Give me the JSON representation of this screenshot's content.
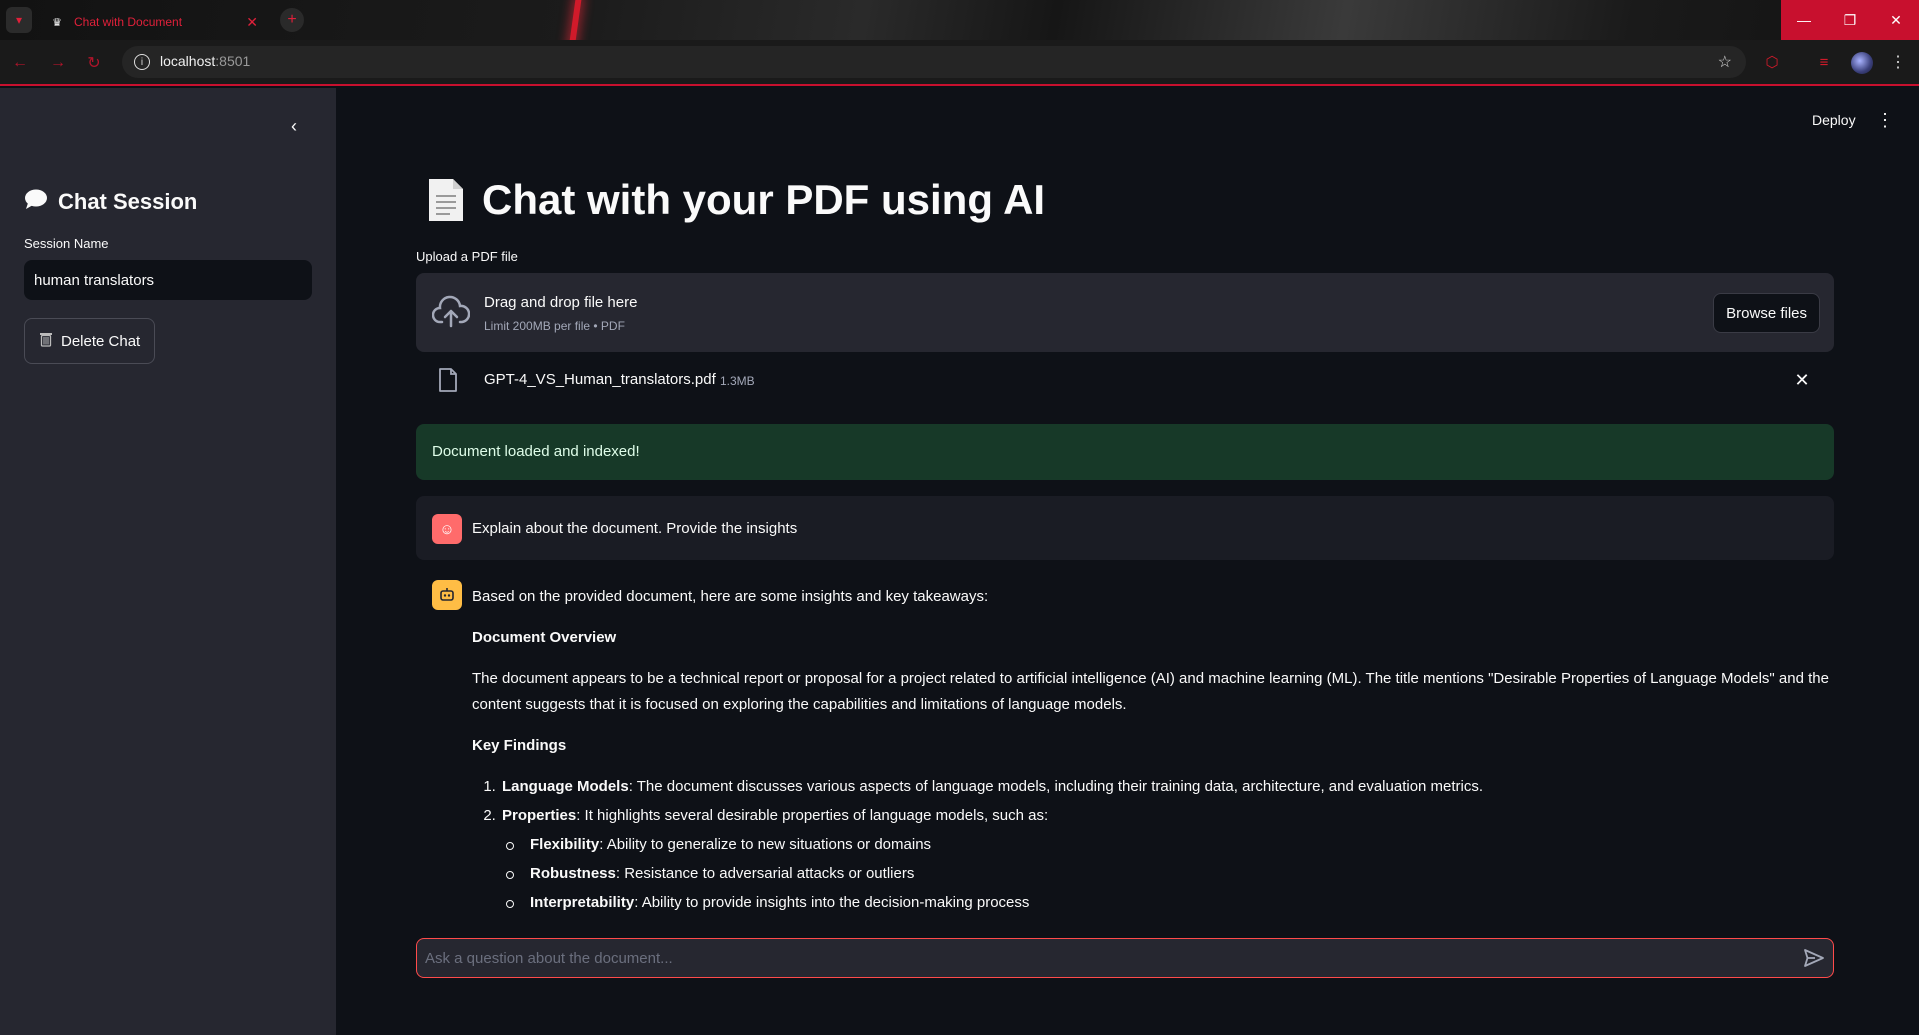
{
  "browser": {
    "tab_title": "Chat with Document",
    "url_host": "localhost",
    "url_port": ":8501"
  },
  "sidebar": {
    "title": "Chat Session",
    "session_label": "Session Name",
    "session_value": "human translators",
    "delete_label": "Delete Chat"
  },
  "header": {
    "deploy_label": "Deploy"
  },
  "main": {
    "title": "Chat with your PDF using AI",
    "upload_label": "Upload a PDF file",
    "dropzone_text": "Drag and drop file here",
    "dropzone_limit": "Limit 200MB per file • PDF",
    "browse_label": "Browse files",
    "file_name": "GPT-4_VS_Human_translators.pdf",
    "file_size": "1.3MB",
    "success_text": "Document loaded and indexed!"
  },
  "chat": {
    "user_message": "Explain about the document. Provide the insights",
    "assistant": {
      "intro": "Based on the provided document, here are some insights and key takeaways:",
      "overview_heading": "Document Overview",
      "overview_text": "The document appears to be a technical report or proposal for a project related to artificial intelligence (AI) and machine learning (ML). The title mentions \"Desirable Properties of Language Models\" and the content suggests that it is focused on exploring the capabilities and limitations of language models.",
      "findings_heading": "Key Findings",
      "findings": [
        {
          "term": "Language Models",
          "text": ": The document discusses various aspects of language models, including their training data, architecture, and evaluation metrics."
        },
        {
          "term": "Properties",
          "text": ": It highlights several desirable properties of language models, such as:"
        }
      ],
      "properties": [
        {
          "term": "Flexibility",
          "text": ": Ability to generalize to new situations or domains"
        },
        {
          "term": "Robustness",
          "text": ": Resistance to adversarial attacks or outliers"
        },
        {
          "term": "Interpretability",
          "text": ": Ability to provide insights into the decision-making process"
        }
      ]
    },
    "input_placeholder": "Ask a question about the document..."
  },
  "colors": {
    "accent": "#ff4b4b",
    "sidebar_bg": "#262730",
    "main_bg": "#0e1117",
    "success_bg": "#173928",
    "user_avatar": "#ff6b6b",
    "bot_avatar": "#ffbd45",
    "browser_accent": "#c8102e"
  },
  "icons": {
    "sidebar_title": "speech-bubble-icon",
    "delete": "wastebasket-icon",
    "title": "document-icon",
    "upload": "cloud-upload-icon",
    "file": "file-icon",
    "send": "send-icon"
  }
}
